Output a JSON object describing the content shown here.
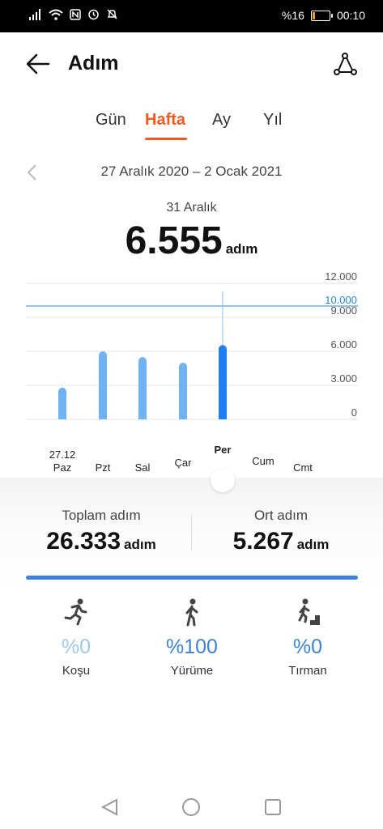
{
  "status": {
    "battery_percent": "%16",
    "time": "00:10",
    "battery_level": 0.16
  },
  "header": {
    "title": "Adım",
    "back_icon": "arrow-left-icon",
    "share_icon": "route-icon"
  },
  "tabs": [
    {
      "label": "Gün",
      "active": false
    },
    {
      "label": "Hafta",
      "active": true
    },
    {
      "label": "Ay",
      "active": false
    },
    {
      "label": "Yıl",
      "active": false
    }
  ],
  "date_range": "27 Aralık 2020 – 2 Ocak 2021",
  "selected_day": {
    "label": "31 Aralık",
    "value": "6.555",
    "unit": "adım"
  },
  "chart_data": {
    "type": "bar",
    "categories": [
      "Paz",
      "Pzt",
      "Sal",
      "Çar",
      "Per",
      "Cum",
      "Cmt"
    ],
    "first_date": "27.12",
    "values": [
      2800,
      6000,
      5500,
      5000,
      6555,
      0,
      0
    ],
    "selected_index": 4,
    "ylim": [
      0,
      12000
    ],
    "yticks": [
      "12.000",
      "9.000",
      "6.000",
      "3.000",
      "0"
    ],
    "goal_value": 10000,
    "goal_label": "10.000",
    "colors": {
      "bar": "#6fb3f5",
      "selected": "#1f7ff0",
      "goal": "#2a86d4",
      "grid": "#e6e6e6"
    }
  },
  "summary": {
    "total_label": "Toplam adım",
    "total_value": "26.333",
    "avg_label": "Ort adım",
    "avg_value": "5.267",
    "unit": "adım"
  },
  "activities": [
    {
      "icon": "running-icon",
      "pct": "%0",
      "label": "Koşu",
      "color": "#9fc8ee"
    },
    {
      "icon": "walking-icon",
      "pct": "%100",
      "label": "Yürüme",
      "color": "#3c82d6"
    },
    {
      "icon": "climbing-icon",
      "pct": "%0",
      "label": "Tırman",
      "color": "#3c82d6"
    }
  ],
  "progress_walk_fraction": 1.0
}
